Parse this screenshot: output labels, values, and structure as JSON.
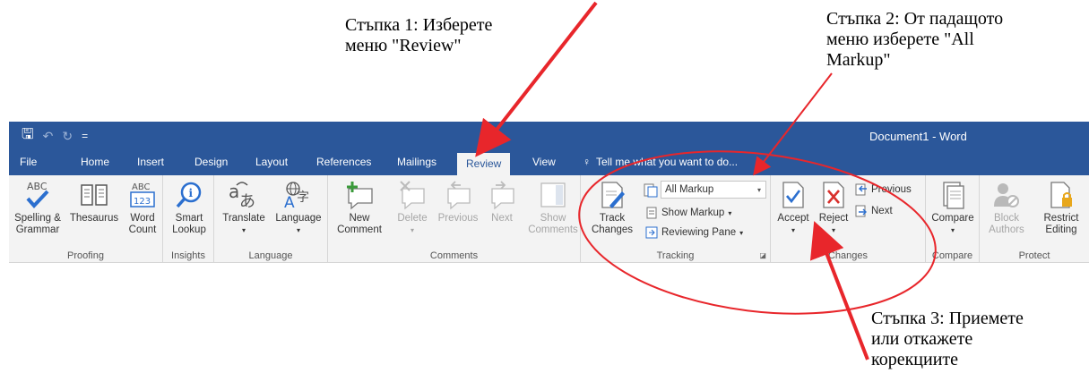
{
  "annotations": {
    "step1": "Стъпка 1: Изберете\nменю \"Review\"",
    "step2": "Стъпка 2: От падащото\nменю изберете \"All\nMarkup\"",
    "step3": "Стъпка 3: Приемете\nили откажете\nкорекциите"
  },
  "titlebar": {
    "doc_title": "Document1 - Word",
    "save_glyph": "🖫",
    "undo_glyph": "↶",
    "redo_glyph": "↻",
    "customize_glyph": "="
  },
  "tabs": [
    "File",
    "Home",
    "Insert",
    "Design",
    "Layout",
    "References",
    "Mailings",
    "Review",
    "View"
  ],
  "active_tab": "Review",
  "tell_me": {
    "glyph": "♀",
    "text": "Tell me what you want to do..."
  },
  "ribbon": {
    "proofing": {
      "label": "Proofing",
      "spelling_line1": "Spelling &",
      "spelling_line2": "Grammar",
      "abc": "ABC",
      "thesaurus": "Thesaurus",
      "wordcount_line1": "Word",
      "wordcount_line2": "Count",
      "wc_abc": "ABC",
      "wc_123": "123"
    },
    "insights": {
      "label": "Insights",
      "smart_line1": "Smart",
      "smart_line2": "Lookup"
    },
    "language": {
      "label": "Language",
      "translate": "Translate",
      "language": "Language"
    },
    "comments": {
      "label": "Comments",
      "new_line1": "New",
      "new_line2": "Comment",
      "delete": "Delete",
      "previous": "Previous",
      "next": "Next",
      "show_line1": "Show",
      "show_line2": "Comments"
    },
    "tracking": {
      "label": "Tracking",
      "track_line1": "Track",
      "track_line2": "Changes",
      "markup_value": "All Markup",
      "show_markup": "Show Markup",
      "reviewing_pane": "Reviewing Pane"
    },
    "changes": {
      "label": "Changes",
      "accept": "Accept",
      "reject": "Reject",
      "previous": "Previous",
      "next": "Next"
    },
    "compare": {
      "label": "Compare",
      "compare": "Compare"
    },
    "protect": {
      "label": "Protect",
      "block_line1": "Block",
      "block_line2": "Authors",
      "restrict_line1": "Restrict",
      "restrict_line2": "Editing"
    }
  },
  "colors": {
    "word_blue": "#2b579a",
    "ribbon_bg": "#f3f3f3",
    "annotation_red": "#e8262b"
  }
}
